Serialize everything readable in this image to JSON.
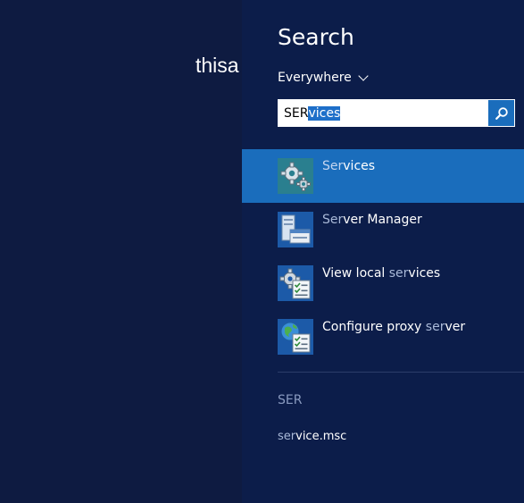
{
  "background": {
    "user_text": "thisa"
  },
  "search_pane": {
    "title": "Search",
    "scope": "Everywhere",
    "query": {
      "typed": "SER",
      "autocomplete": "vices"
    },
    "results": [
      {
        "match": "Ser",
        "rest": "vices",
        "prefix": "",
        "icon": "services-gear-icon",
        "selected": true
      },
      {
        "prefix": "",
        "match": "Ser",
        "rest": "ver Manager",
        "icon": "server-manager-icon",
        "selected": false
      },
      {
        "prefix": "View local ",
        "match": "ser",
        "rest": "vices",
        "icon": "view-local-services-icon",
        "selected": false
      },
      {
        "prefix": "Configure proxy ",
        "match": "ser",
        "rest": "ver",
        "icon": "configure-proxy-server-icon",
        "selected": false
      }
    ],
    "suggestions_header": "SER",
    "suggestion": {
      "match": "ser",
      "rest": "vice.msc"
    }
  },
  "colors": {
    "accent": "#1a6dbc",
    "pane": "#0c1d4a",
    "desktop": "#0e1b41"
  }
}
